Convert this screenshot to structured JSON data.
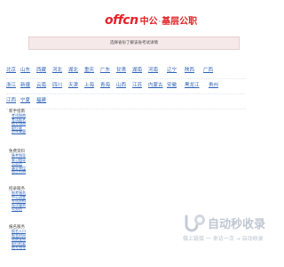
{
  "header": {
    "logo_en": "offcn",
    "logo_cn": "中公",
    "logo_sep": "·",
    "logo_sub": "基层公职"
  },
  "banner": {
    "text": "选择省份了解该省考试详情"
  },
  "provinces": {
    "row1": [
      "北京",
      "山东",
      "西藏",
      "河北",
      "湖北",
      "重庆",
      "广东",
      "甘肃",
      "湖南",
      "河南",
      "辽宁",
      "陕西",
      "广西"
    ],
    "row2": [
      "浙江",
      "新疆",
      "云南",
      "四川",
      "天津",
      "上海",
      "青海",
      "山西",
      "江苏",
      "内蒙古",
      "安徽",
      "黑龙江",
      "贵州"
    ],
    "row3": [
      "江西",
      "宁夏",
      "福建"
    ]
  },
  "sidebar": {
    "groups": [
      {
        "title": "新手指南",
        "links": [
          "考试指南",
          "考试报名",
          "报考指南",
          "职位表",
          "历年真题"
        ]
      },
      {
        "title": "免费资料",
        "links": [
          "备考指导",
          "复习指导",
          "公务员",
          "事业单位",
          "国企招聘"
        ]
      },
      {
        "title": "招录服务",
        "links": [
          "报考服务",
          "中公讲堂",
          "考试资料",
          "面试服务",
          "公务员"
        ]
      },
      {
        "title": "报名服务",
        "links": [
          "报名入口",
          "报名时间",
          "成绩查询",
          "职位检索",
          "报考指导"
        ]
      }
    ]
  },
  "watermark": {
    "text": "自动秒收录",
    "sub": "做上链接 一 来访一次 → 自动收录"
  }
}
